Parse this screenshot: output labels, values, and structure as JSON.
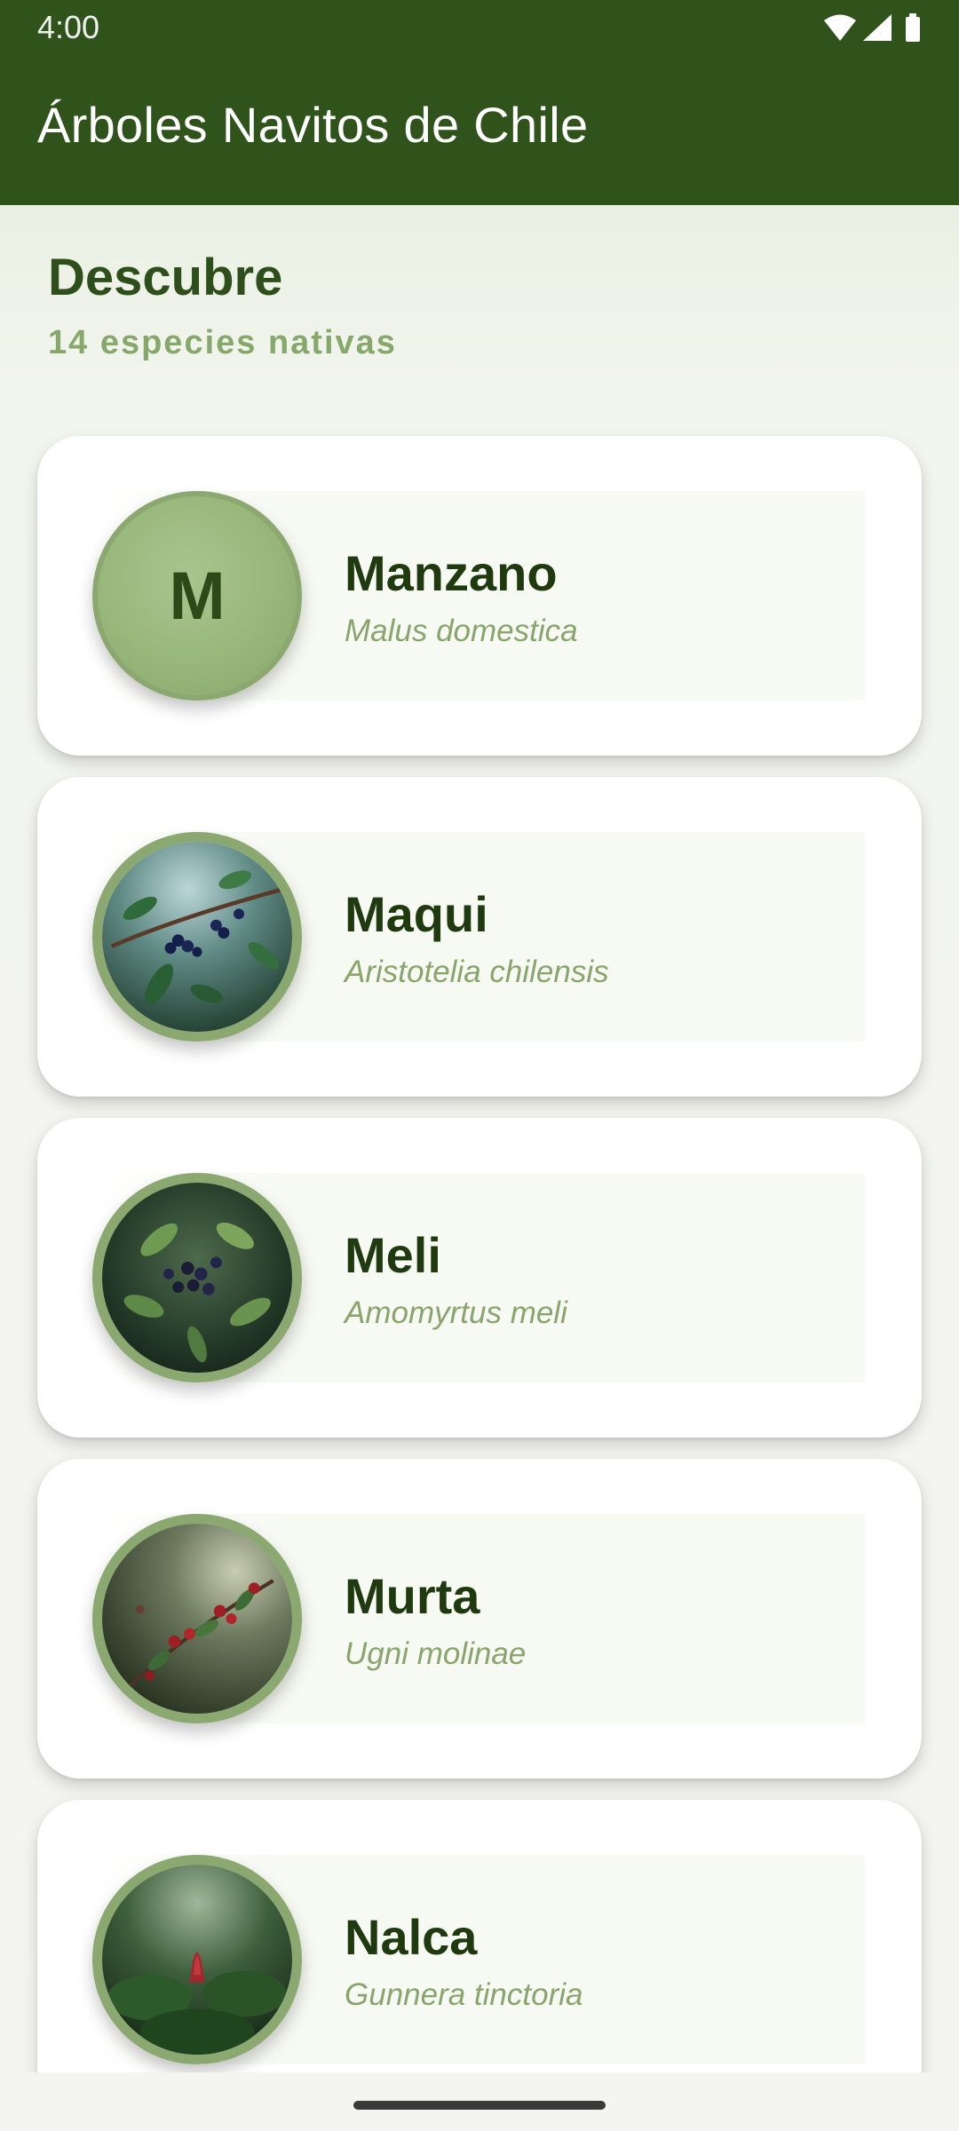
{
  "status": {
    "time": "4:00",
    "icons": [
      "wifi-icon",
      "signal-icon",
      "battery-icon"
    ]
  },
  "appbar": {
    "title": "Árboles Navitos de Chile"
  },
  "section": {
    "title": "Descubre",
    "subtitle": "14 especies nativas"
  },
  "trees": [
    {
      "name": "Manzano",
      "scientific": "Malus domestica",
      "avatar": "M"
    },
    {
      "name": "Maqui",
      "scientific": "Aristotelia chilensis",
      "image": "maqui-berries-photo"
    },
    {
      "name": "Meli",
      "scientific": "Amomyrtus meli",
      "image": "meli-berries-photo"
    },
    {
      "name": "Murta",
      "scientific": "Ugni molinae",
      "image": "murta-berries-photo"
    },
    {
      "name": "Nalca",
      "scientific": "Gunnera tinctoria",
      "image": "nalca-plant-photo"
    }
  ],
  "colors": {
    "appbar": "#30531c",
    "title_green": "#2e4f1b",
    "subtitle_green": "#86a86a",
    "name_dark": "#1e3a0e",
    "avatar_ring": "#8aa870"
  }
}
